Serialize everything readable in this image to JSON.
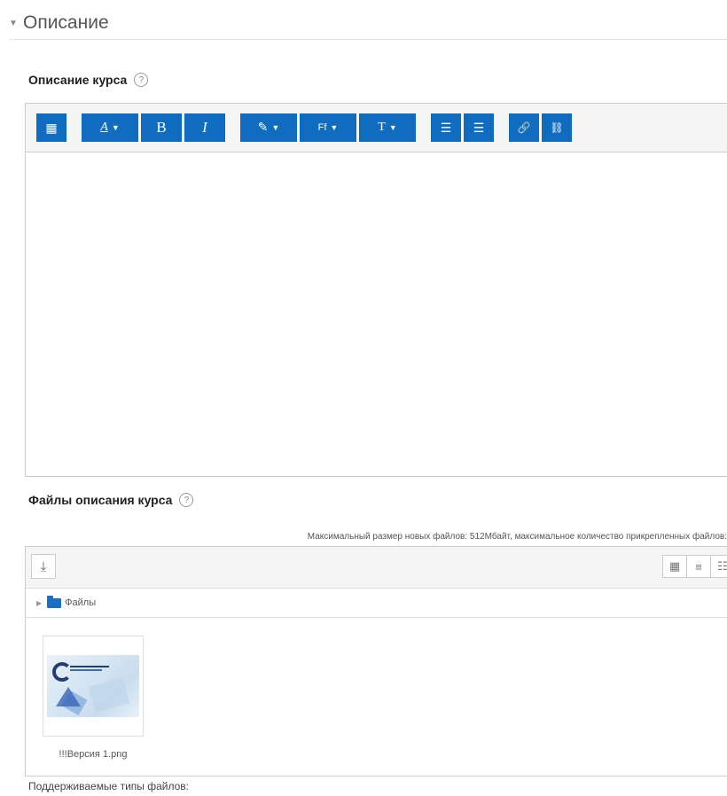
{
  "section": {
    "title": "Описание",
    "toggle_icon": "triangle-down-icon"
  },
  "course_description": {
    "label": "Описание курса",
    "help_icon_glyph": "?",
    "toolbar": [
      {
        "group": "collapse",
        "buttons": [
          {
            "name": "show-more-buttons-button",
            "icon": "keyboard-grid-icon",
            "glyph": "▦"
          }
        ]
      },
      {
        "group": "style",
        "buttons": [
          {
            "name": "paragraph-style-button",
            "icon": "text-style-icon",
            "glyph": "A",
            "has_caret": true
          },
          {
            "name": "bold-button",
            "icon": "bold-icon",
            "glyph": "B"
          },
          {
            "name": "italic-button",
            "icon": "italic-icon",
            "glyph": "I"
          }
        ]
      },
      {
        "group": "format",
        "buttons": [
          {
            "name": "font-color-button",
            "icon": "pen-icon",
            "glyph": "✎",
            "has_caret": true
          },
          {
            "name": "font-family-button",
            "icon": "font-family-icon",
            "glyph": "Ff",
            "has_caret": true
          },
          {
            "name": "font-size-button",
            "icon": "font-size-icon",
            "glyph": "T",
            "has_caret": true
          }
        ]
      },
      {
        "group": "list",
        "buttons": [
          {
            "name": "unordered-list-button",
            "icon": "bullet-list-icon",
            "glyph": "☰"
          },
          {
            "name": "ordered-list-button",
            "icon": "numbered-list-icon",
            "glyph": "☰"
          }
        ]
      },
      {
        "group": "links",
        "buttons": [
          {
            "name": "link-button",
            "icon": "link-icon",
            "glyph": "🔗"
          },
          {
            "name": "unlink-button",
            "icon": "unlink-icon",
            "glyph": "⛓"
          }
        ]
      }
    ]
  },
  "course_files": {
    "label": "Файлы описания курса",
    "help_icon_glyph": "?",
    "limits_text": "Максимальный размер новых файлов: 512Мбайт, максимальное количество прикрепленных файлов:",
    "upload_icon": "download-tray-icon",
    "view_modes": [
      {
        "name": "icons-view-button",
        "icon": "grid-view-icon",
        "glyph": "▦"
      },
      {
        "name": "list-view-button",
        "icon": "list-view-icon",
        "glyph": "≡"
      },
      {
        "name": "tree-view-button",
        "icon": "tree-view-icon",
        "glyph": "☷"
      }
    ],
    "path": {
      "folder_name": "Файлы"
    },
    "files": [
      {
        "name": "!!!Версия 1.png"
      }
    ]
  },
  "supported_types_label": "Поддерживаемые типы файлов:"
}
